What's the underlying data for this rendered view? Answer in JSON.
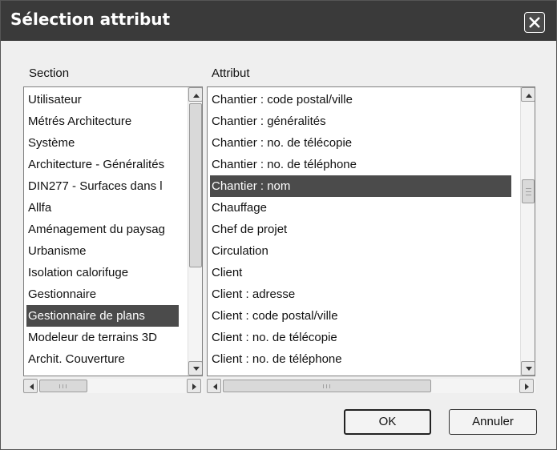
{
  "dialog": {
    "title": "Sélection attribut",
    "ok_label": "OK",
    "cancel_label": "Annuler"
  },
  "section": {
    "label": "Section",
    "items": [
      {
        "label": "Utilisateur"
      },
      {
        "label": "Métrés Architecture"
      },
      {
        "label": "Système"
      },
      {
        "label": "Architecture - Généralités"
      },
      {
        "label": "DIN277 - Surfaces dans l"
      },
      {
        "label": "Allfa"
      },
      {
        "label": "Aménagement du paysag"
      },
      {
        "label": "Urbanisme"
      },
      {
        "label": "Isolation calorifuge"
      },
      {
        "label": "Gestionnaire"
      },
      {
        "label": "Gestionnaire de plans",
        "selected": true
      },
      {
        "label": "Modeleur de terrains 3D"
      },
      {
        "label": "Archit. Couverture"
      }
    ]
  },
  "attribut": {
    "label": "Attribut",
    "items": [
      {
        "label": "Chantier : code postal/ville"
      },
      {
        "label": "Chantier : généralités"
      },
      {
        "label": "Chantier : no. de télécopie"
      },
      {
        "label": "Chantier : no. de téléphone"
      },
      {
        "label": "Chantier : nom",
        "selected": true
      },
      {
        "label": "Chauffage"
      },
      {
        "label": "Chef de projet"
      },
      {
        "label": "Circulation"
      },
      {
        "label": "Client"
      },
      {
        "label": "Client : adresse"
      },
      {
        "label": "Client : code postal/ville"
      },
      {
        "label": "Client : no. de télécopie"
      },
      {
        "label": "Client : no. de téléphone"
      }
    ]
  },
  "colors": {
    "titlebar": "#3a3a3a",
    "selection": "#4b4b4b",
    "dialog_bg": "#efefef"
  },
  "icons": [
    "close-icon",
    "scroll-up-arrow-icon",
    "scroll-down-arrow-icon",
    "scroll-left-arrow-icon",
    "scroll-right-arrow-icon"
  ]
}
